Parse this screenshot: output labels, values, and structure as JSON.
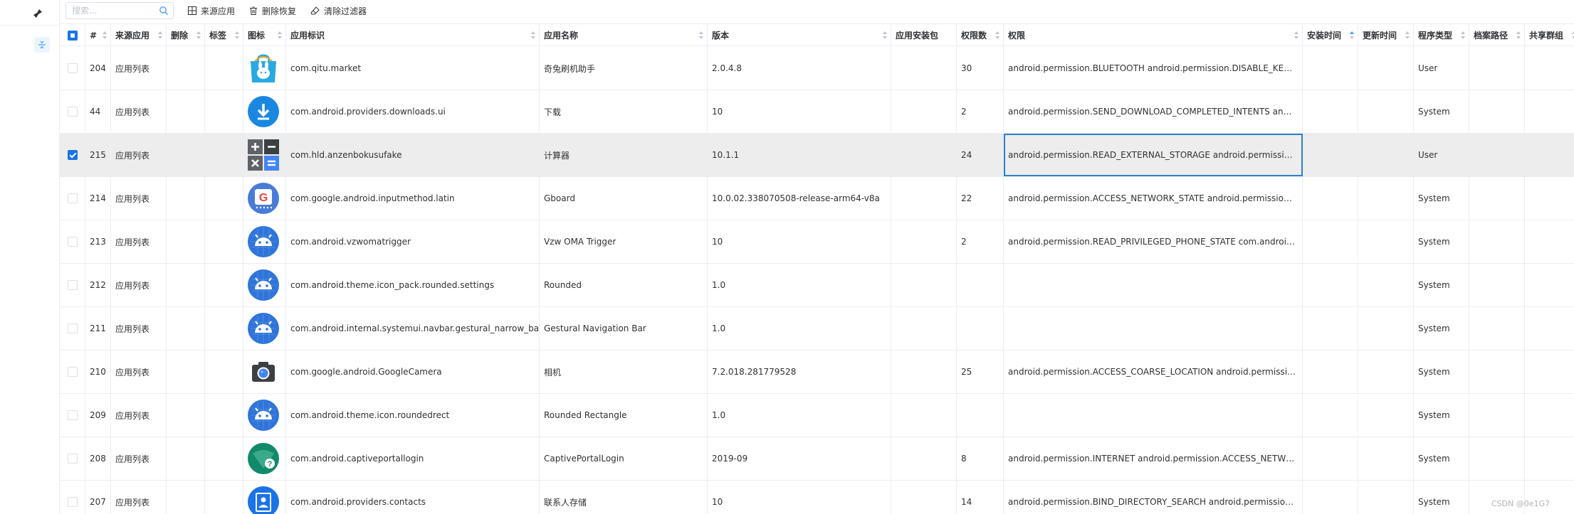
{
  "toolbar": {
    "search_placeholder": "搜索...",
    "source_app_label": "来源应用",
    "delete_restore_label": "删除恢复",
    "clear_filter_label": "清除过滤器"
  },
  "columns": {
    "index": "#",
    "source": "来源应用",
    "deleted": "删除",
    "tag": "标签",
    "icon": "图标",
    "package": "应用标识",
    "name": "应用名称",
    "version": "版本",
    "install_pkg": "应用安装包",
    "perm_count": "权限数",
    "permissions": "权限",
    "install_time": "安装时间",
    "update_time": "更新时间",
    "program_type": "程序类型",
    "archive_path": "档案路径",
    "shared_group": "共享群组"
  },
  "rows": [
    {
      "id": "204",
      "source": "应用列表",
      "package": "com.qitu.market",
      "name": "奇兔刷机助手",
      "version": "2.0.4.8",
      "perm_count": "30",
      "permissions": "android.permission.BLUETOOTH  android.permission.DISABLE_KEYGUARD",
      "type": "User",
      "icon": "qitu-icon",
      "checked": false
    },
    {
      "id": "44",
      "source": "应用列表",
      "package": "com.android.providers.downloads.ui",
      "name": "下载",
      "version": "10",
      "perm_count": "2",
      "permissions": "android.permission.SEND_DOWNLOAD_COMPLETED_INTENTS  android.permission.ACCESS",
      "type": "System",
      "icon": "download-icon",
      "checked": false
    },
    {
      "id": "215",
      "source": "应用列表",
      "package": "com.hld.anzenbokusufake",
      "name": "计算器",
      "version": "10.1.1",
      "perm_count": "24",
      "permissions": "android.permission.READ_EXTERNAL_STORAGE  android.permission.INTERNET",
      "type": "User",
      "icon": "calculator-icon",
      "checked": true
    },
    {
      "id": "214",
      "source": "应用列表",
      "package": "com.google.android.inputmethod.latin",
      "name": "Gboard",
      "version": "10.0.02.338070508-release-arm64-v8a",
      "perm_count": "22",
      "permissions": "android.permission.ACCESS_NETWORK_STATE  android.permission.ACCESS",
      "type": "System",
      "icon": "gboard-icon",
      "checked": false
    },
    {
      "id": "213",
      "source": "应用列表",
      "package": "com.android.vzwomatrigger",
      "name": "Vzw OMA Trigger",
      "version": "10",
      "perm_count": "2",
      "permissions": "android.permission.READ_PRIVILEGED_PHONE_STATE  com.android.omadm",
      "type": "System",
      "icon": "android-icon",
      "checked": false
    },
    {
      "id": "212",
      "source": "应用列表",
      "package": "com.android.theme.icon_pack.rounded.settings",
      "name": "Rounded",
      "version": "1.0",
      "perm_count": "",
      "permissions": "",
      "type": "System",
      "icon": "android-icon",
      "checked": false
    },
    {
      "id": "211",
      "source": "应用列表",
      "package": "com.android.internal.systemui.navbar.gestural_narrow_back",
      "name": "Gestural Navigation Bar",
      "version": "1.0",
      "perm_count": "",
      "permissions": "",
      "type": "System",
      "icon": "android-icon",
      "checked": false
    },
    {
      "id": "210",
      "source": "应用列表",
      "package": "com.google.android.GoogleCamera",
      "name": "相机",
      "version": "7.2.018.281779528",
      "perm_count": "25",
      "permissions": "android.permission.ACCESS_COARSE_LOCATION  android.permission.CAMERA",
      "type": "System",
      "icon": "camera-icon",
      "checked": false
    },
    {
      "id": "209",
      "source": "应用列表",
      "package": "com.android.theme.icon.roundedrect",
      "name": "Rounded Rectangle",
      "version": "1.0",
      "perm_count": "",
      "permissions": "",
      "type": "System",
      "icon": "android-icon",
      "checked": false
    },
    {
      "id": "208",
      "source": "应用列表",
      "package": "com.android.captiveportallogin",
      "name": "CaptivePortalLogin",
      "version": "2019-09",
      "perm_count": "8",
      "permissions": "android.permission.INTERNET  android.permission.ACCESS_NETWORK_STATE",
      "type": "System",
      "icon": "captive-portal-icon",
      "checked": false
    },
    {
      "id": "207",
      "source": "应用列表",
      "package": "com.android.providers.contacts",
      "name": "联系人存储",
      "version": "10",
      "perm_count": "14",
      "permissions": "android.permission.BIND_DIRECTORY_SEARCH  android.permission.READ",
      "type": "System",
      "icon": "contacts-icon",
      "checked": false
    }
  ],
  "watermark": "CSDN @0e1G7",
  "colors": {
    "accent": "#1a73e8",
    "selected_row": "#ededed",
    "focus_border": "#2d7fd3",
    "border": "#ebeef5"
  }
}
